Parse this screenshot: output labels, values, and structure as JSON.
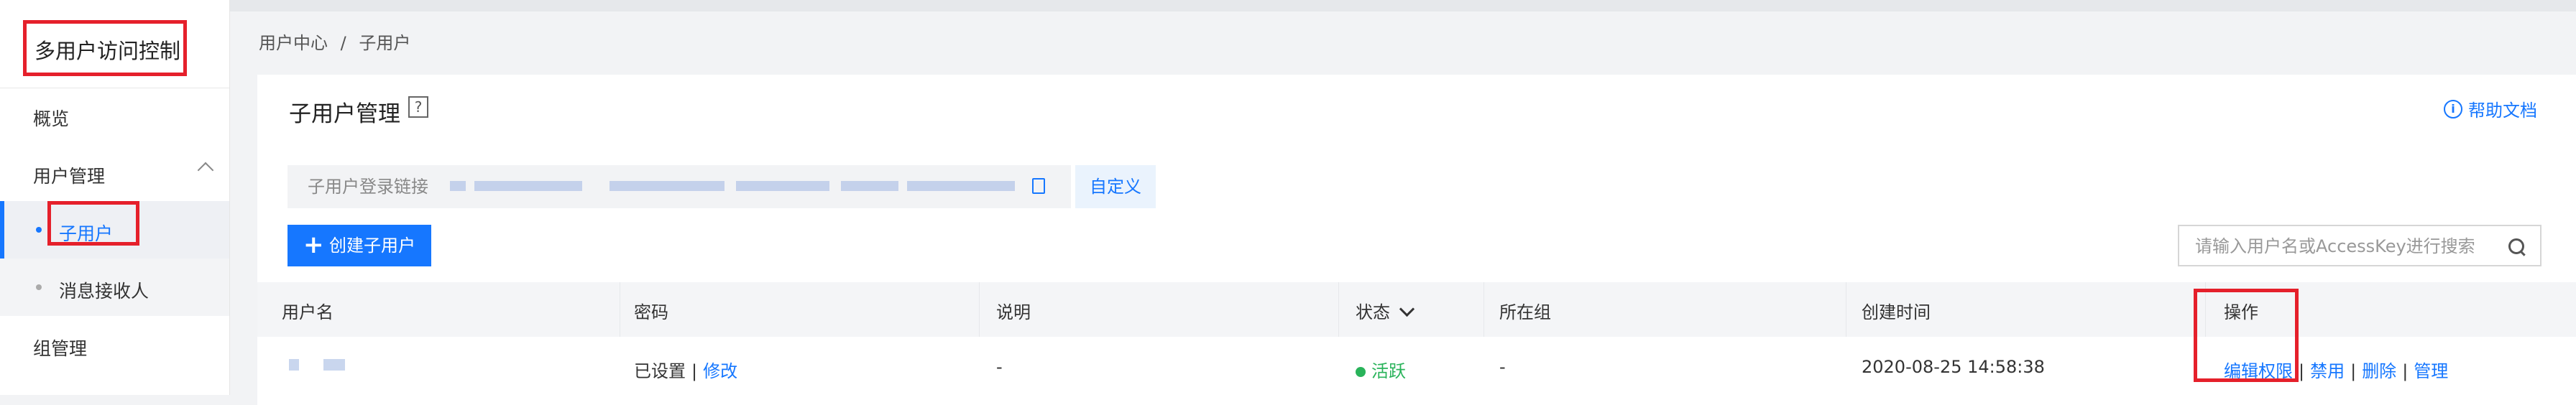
{
  "sidebar": {
    "title": "多用户访问控制",
    "overview": "概览",
    "user_mgmt": "用户管理",
    "sub_user": "子用户",
    "message_receiver": "消息接收人",
    "group_mgmt": "组管理"
  },
  "breadcrumb": [
    "用户中心",
    "/",
    "子用户"
  ],
  "page": {
    "title": "子用户管理",
    "help_q": "?",
    "help_doc": "帮助文档",
    "info_icon": "i"
  },
  "login_link": {
    "label": "子用户登录链接",
    "custom_button": "自定义"
  },
  "toolbar": {
    "create_button": "创建子用户",
    "plus": "+",
    "search_placeholder": "请输入用户名或AccessKey进行搜索"
  },
  "table": {
    "headers": [
      "用户名",
      "密码",
      "说明",
      "状态",
      "所在组",
      "创建时间",
      "操作"
    ],
    "rows": [
      {
        "password_state": "已设置",
        "password_action": "修改",
        "description": "-",
        "status": "活跃",
        "group": "-",
        "created": "2020-08-25 14:58:38",
        "actions": [
          "编辑权限",
          "禁用",
          "删除",
          "管理"
        ],
        "sep": "|"
      }
    ]
  },
  "colors": {
    "accent": "#1677ff",
    "highlight": "#e5202b",
    "status_active": "#29b35a"
  }
}
